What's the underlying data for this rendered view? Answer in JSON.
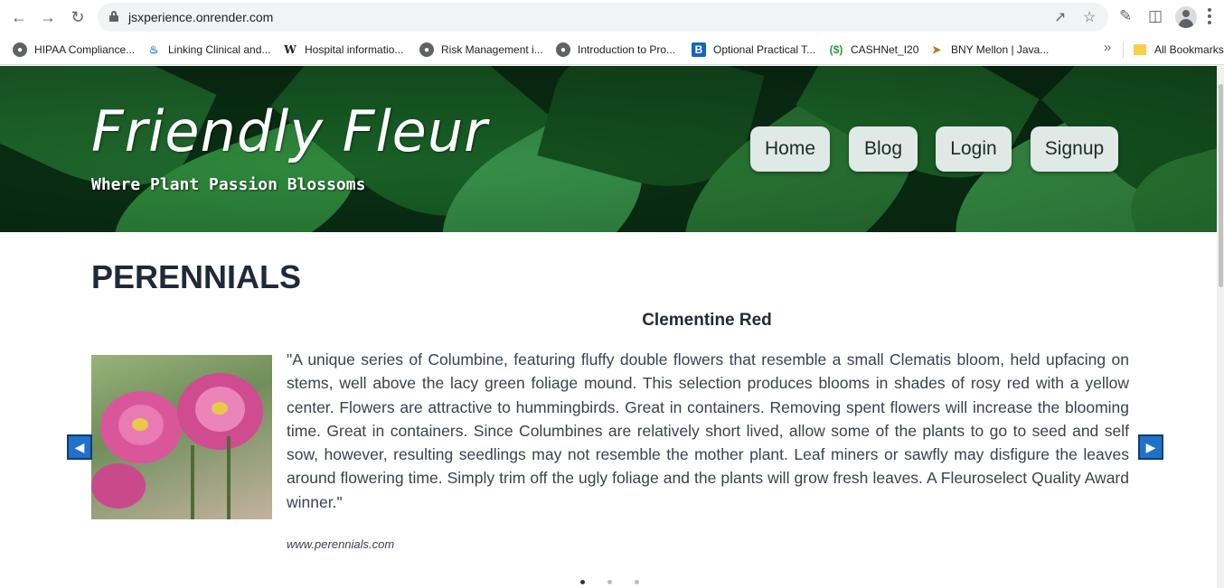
{
  "browser": {
    "url": "jsxperience.onrender.com",
    "bookmarks": [
      {
        "label": "HIPAA Compliance...",
        "icon": "globe-icon"
      },
      {
        "label": "Linking Clinical and...",
        "icon": "flame-icon"
      },
      {
        "label": "Hospital informatio...",
        "icon": "wikipedia-icon"
      },
      {
        "label": "Risk Management i...",
        "icon": "globe-icon"
      },
      {
        "label": "Introduction to Pro...",
        "icon": "globe-icon"
      },
      {
        "label": "Optional Practical T...",
        "icon": "b-logo-icon"
      },
      {
        "label": "CASHNet_I20",
        "icon": "cashnet-icon"
      },
      {
        "label": "BNY Mellon | Java...",
        "icon": "bny-icon"
      }
    ],
    "all_bookmarks": "All Bookmarks"
  },
  "site": {
    "brand": "Friendly Fleur",
    "tagline": "Where Plant Passion Blossoms",
    "nav": [
      "Home",
      "Blog",
      "Login",
      "Signup"
    ]
  },
  "main": {
    "section_title": "PERENNIALS",
    "slide": {
      "title": "Clementine Red",
      "description": "\"A unique series of Columbine, featuring fluffy double flowers that resemble a small Clematis bloom, held upfacing on stems, well above the lacy green foliage mound. This selection produces blooms in shades of rosy red with a yellow center. Flowers are attractive to hummingbirds. Great in containers. Removing spent flowers will increase the blooming time. Great in containers. Since Columbines are relatively short lived, allow some of the plants to go to seed and self sow, however, resulting seedlings may not resemble the mother plant. Leaf miners or sawfly may disfigure the leaves around flowering time. Simply trim off the ugly foliage and the plants will grow fresh leaves. A Fleuroselect Quality Award winner.\"",
      "source": "www.perennials.com"
    },
    "carousel": {
      "total": 3,
      "active": 1
    },
    "colors": {
      "accent_button": "#1f72c7",
      "nav_pill": "#dfe9e6",
      "heading": "#1f2a38"
    }
  }
}
